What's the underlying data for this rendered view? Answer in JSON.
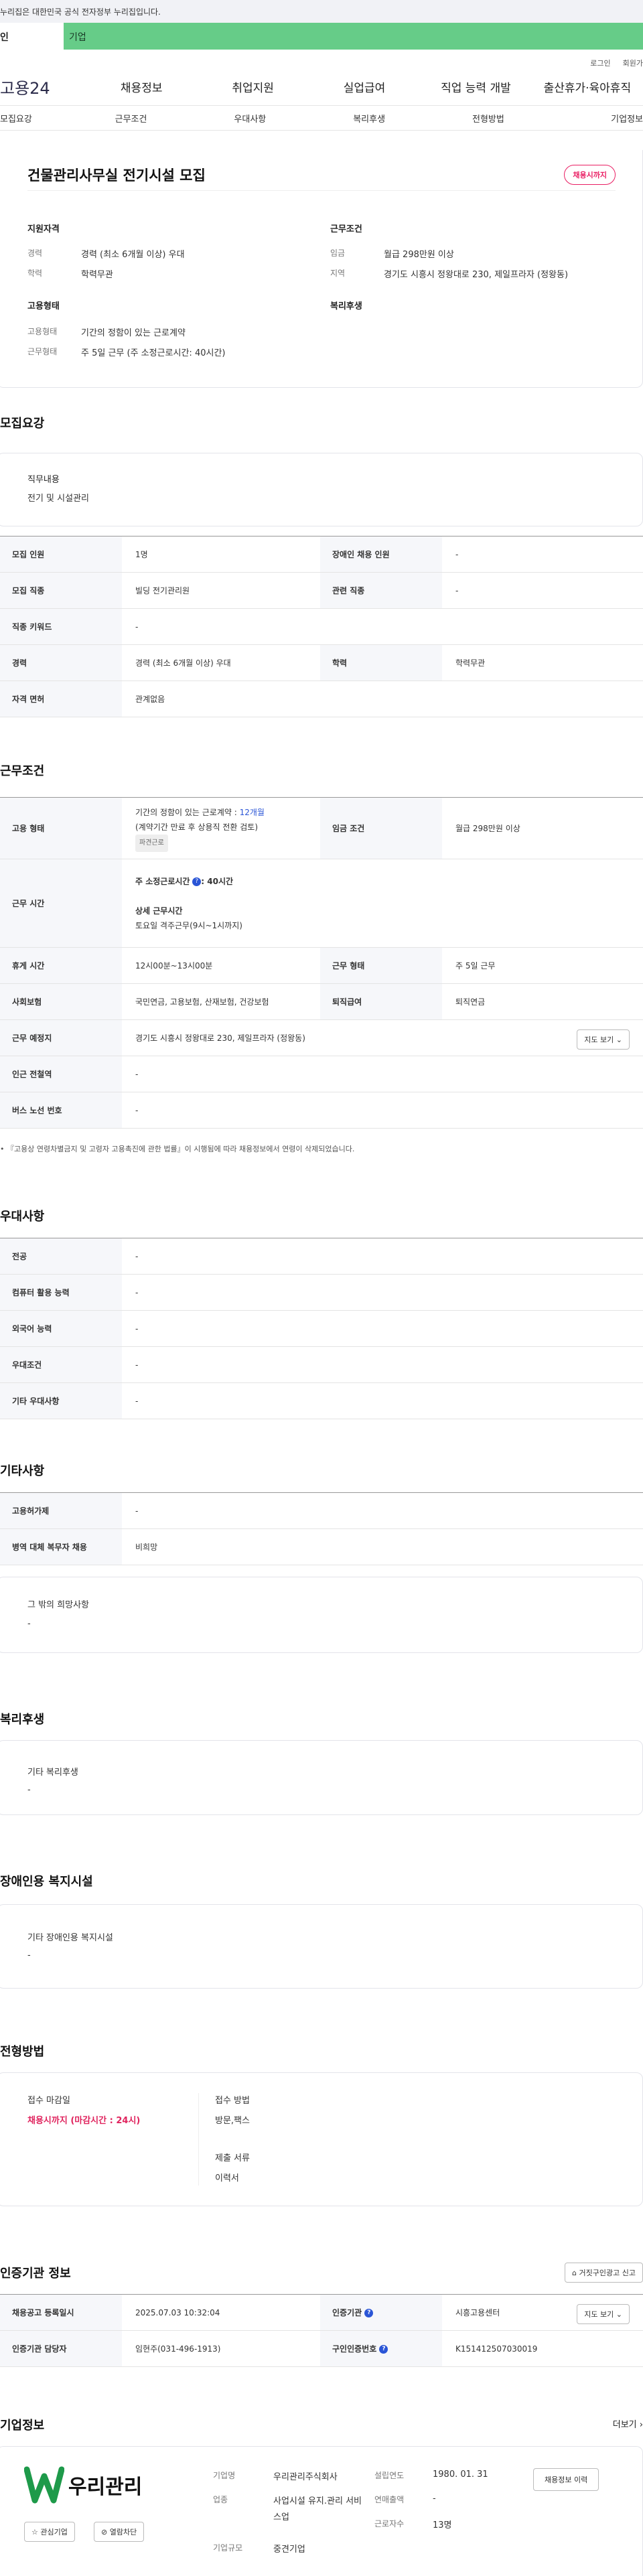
{
  "topbar": {
    "notice": "누리집은 대한민국 공식 전자정부 누리집입니다."
  },
  "tabs": {
    "personal": "인",
    "company": "기업"
  },
  "util": {
    "login": "로그인",
    "join": "회원가"
  },
  "gnb": {
    "logo": "고용24",
    "items": [
      "채용정보",
      "취업지원",
      "실업급여",
      "직업 능력 개발",
      "출산휴가·육아휴직"
    ]
  },
  "subnav": [
    "모집요강",
    "근무조건",
    "우대사항",
    "복리후생",
    "전형방법",
    "기업정보"
  ],
  "summary": {
    "title": "건물관리사무실 전기시설 모집",
    "badge": "채용시까지",
    "qualification_head": "지원자격",
    "experience_label": "경력",
    "experience": "경력 (최소 6개월 이상) 우대",
    "education_label": "학력",
    "education": "학력무관",
    "worktype_head": "고용형태",
    "worktype_label": "고용형태",
    "worktype": "기간의 정함이 있는 근로계약",
    "workform_label": "근무형태",
    "workform": "주 5일 근무 (주 소정근로시간: 40시간)",
    "conditions_head": "근무조건",
    "wage_label": "임금",
    "wage": "월급 298만원 이상",
    "region_label": "지역",
    "region": "경기도 시흥시 정왕대로 230, 제일프라자 (정왕동)",
    "welfare_head": "복리후생"
  },
  "recruit": {
    "title": "모집요강",
    "job_label": "직무내용",
    "job": "전기 및 시설관리",
    "rows": [
      [
        "모집 인원",
        "1명",
        "장애인 채용 인원",
        "-"
      ],
      [
        "모집 직종",
        "빌딩 전기관리원",
        "관련 직종",
        "-"
      ],
      [
        "직종 키워드",
        "-"
      ],
      [
        "경력",
        "경력 (최소 6개월 이상) 우대",
        "학력",
        "학력무관"
      ],
      [
        "자격 면허",
        "관계없음"
      ]
    ]
  },
  "conditions": {
    "title": "근무조건",
    "emp_label": "고용 형태",
    "emp_line1": "기간의 정함이 있는 근로계약 : ",
    "emp_period": "12개월",
    "emp_line2": "(계약기간 만료 후 상용직 전환 검토)",
    "emp_chip": "파견근로",
    "wage_label": "임금 조건",
    "wage": "월급 298만원 이상",
    "hours_label": "근무 시간",
    "hours_main": "주 소정근로시간",
    "hours_value": ": 40시간",
    "hours_detail_head": "상세 근무시간",
    "hours_detail": "토요일 격주근무(9시~1시까지)",
    "break_label": "휴게 시간",
    "break": "12시00분~13시00분",
    "form_label": "근무 형태",
    "form": "주 5일 근무",
    "ins_label": "사회보험",
    "ins": "국민연금, 고용보험, 산재보험, 건강보험",
    "ret_label": "퇴직급여",
    "ret": "퇴직연금",
    "place_label": "근무 예정지",
    "place": "경기도 시흥시 정왕대로 230, 제일프라자 (정왕동)",
    "map_btn": "지도 보기",
    "subway_label": "인근 전철역",
    "subway": "-",
    "bus_label": "버스 노선 번호",
    "bus": "-",
    "note": "『고용상 연령차별금지 및 고령자 고용촉진에 관한 법률』이 시행됨에 따라 채용정보에서 연령이 삭제되었습니다."
  },
  "preference": {
    "title": "우대사항",
    "rows": [
      [
        "전공",
        "-"
      ],
      [
        "컴퓨터 활용 능력",
        "-"
      ],
      [
        "외국어 능력",
        "-"
      ],
      [
        "우대조건",
        "-"
      ],
      [
        "기타 우대사항",
        "-"
      ]
    ]
  },
  "etc": {
    "title": "기타사항",
    "rows": [
      [
        "고용허가제",
        "-"
      ],
      [
        "병역 대체 복무자 채용",
        "비희망"
      ]
    ],
    "other_label": "그 밖의 희망사항",
    "other": "-"
  },
  "welfare": {
    "title": "복리후생",
    "label": "기타 복리후생",
    "value": "-"
  },
  "disabled": {
    "title": "장애인용 복지시설",
    "label": "기타 장애인용 복지시설",
    "value": "-"
  },
  "screening": {
    "title": "전형방법",
    "deadline_label": "접수 마감일",
    "deadline": "채용시까지 (마감시간 : 24시)",
    "method_label": "접수 방법",
    "method": "방문,팩스",
    "docs_label": "제출 서류",
    "docs": "이력서"
  },
  "agency": {
    "title": "인증기관 정보",
    "report_btn": "거짓구인광고 신고",
    "reg_label": "채용공고 등록일시",
    "reg": "2025.07.03 10:32:04",
    "org_label": "인증기관",
    "org": "시흥고용센터",
    "map_btn": "지도 보기",
    "mgr_label": "인증기관 담당자",
    "mgr": "임현주(031-496-1913)",
    "num_label": "구인인증번호",
    "num": "K151412507030019"
  },
  "company": {
    "title": "기업정보",
    "more": "더보기",
    "logo_text": "우리관리",
    "fav_btn": "관심기업",
    "block_btn": "열람차단",
    "name_label": "기업명",
    "name": "우리관리주식회사",
    "industry_label": "업종",
    "industry": "사업시설 유지.관리 서비스업",
    "size_label": "기업규모",
    "size": "중견기업",
    "est_label": "설립연도",
    "est": "1980. 01. 31",
    "sales_label": "연매출액",
    "sales": "-",
    "emp_label": "근로자수",
    "emp": "13명",
    "history_btn": "채용정보 이력"
  },
  "colors": {
    "accent_green": "#66cc88",
    "brand_red": "#e0245e",
    "brand_blue": "#2a55d6",
    "logo_green": "#1e9a4a"
  }
}
